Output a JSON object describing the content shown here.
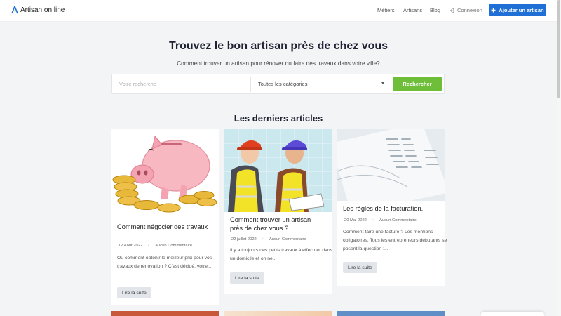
{
  "nav": {
    "brand": "Artisan on line",
    "links": [
      "Métiers",
      "Artisans",
      "Blog"
    ],
    "login": "Connexion",
    "add_button": "Ajouter un artisan"
  },
  "hero": {
    "title": "Trouvez le bon artisan près de chez vous",
    "subtitle": "Comment trouver un artisan pour rénover ou faire des travaux dans votre ville?"
  },
  "search": {
    "placeholder": "Votre recherche",
    "category": "Toutes les catégories",
    "button": "Rechercher"
  },
  "section_title": "Les derniers articles",
  "articles": [
    {
      "title": "Comment négocier des travaux",
      "date": "12 Août 2022",
      "comments": "Aucun Commentaire",
      "excerpt": "Ou comment obtenir le meilleur prix pour vos travaux de rénovation ? C'est décidé, votre...",
      "button": "Lire la suite"
    },
    {
      "title": "Comment trouver un artisan près de chez vous ?",
      "date": "22 juillet 2022",
      "comments": "Aucun Commentaire",
      "excerpt": "Il y a toujours des petits travaux à effectuer dans un domicile et on ne...",
      "button": "Lire la suite"
    },
    {
      "title": "Les règles de la facturation.",
      "date": "20 Mai 2022",
      "comments": "Aucun Commentaire",
      "excerpt": "Comment faire une facture ? Les mentions obligatoires. Tous les entrepreneurs débutants se posent la question :...",
      "button": "Lire la suite"
    }
  ],
  "colors": {
    "primary": "#1f6fd6",
    "search_button": "#6fbe3a",
    "page_background": "#f3f4f6"
  },
  "icons": {
    "logo": "house-logo-icon",
    "login": "login-arrow-icon",
    "add": "plus-icon",
    "select": "caret-down-icon"
  }
}
